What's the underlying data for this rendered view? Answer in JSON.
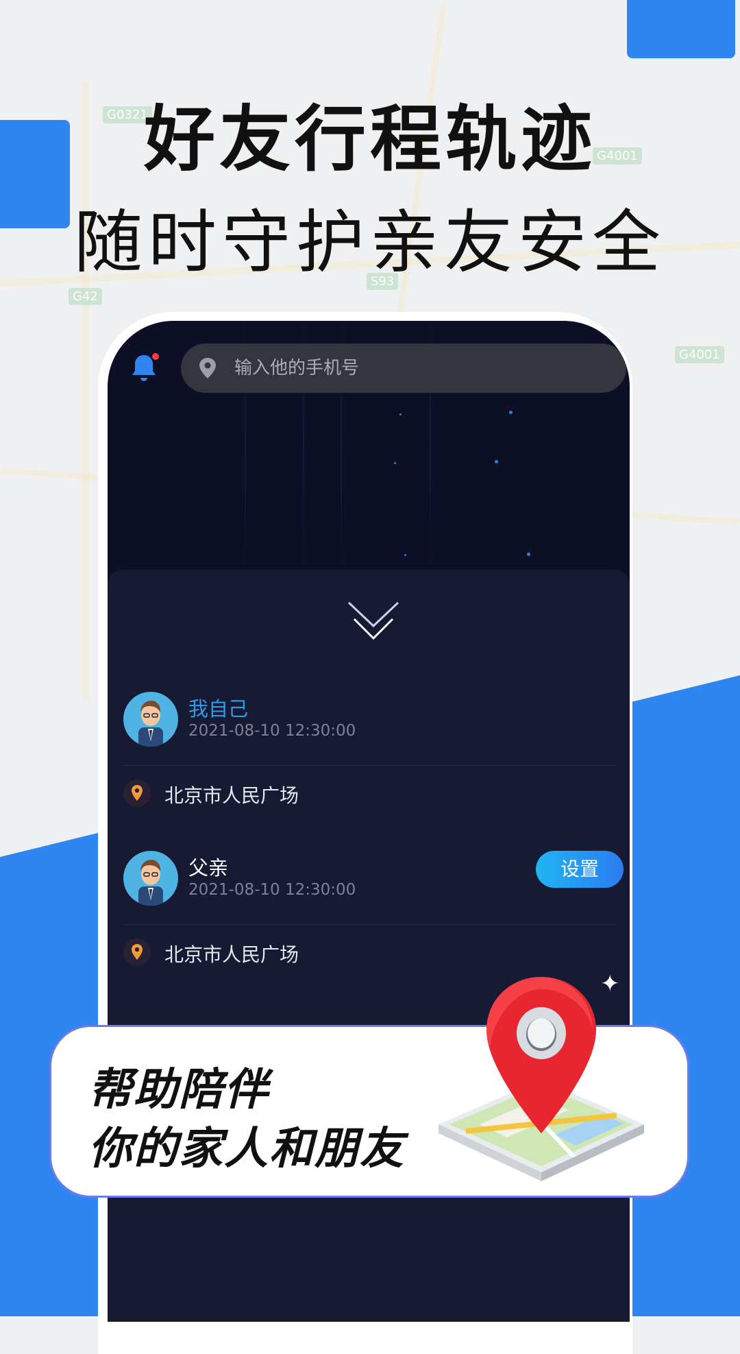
{
  "headline": {
    "line1": "好友行程轨迹",
    "line2": "随时守护亲友安全"
  },
  "map_labels": [
    "G0321",
    "G4001",
    "G42",
    "S93",
    "G4001"
  ],
  "search": {
    "placeholder": "输入他的手机号"
  },
  "contacts": [
    {
      "name": "我自己",
      "name_color": "#2f9be8",
      "time": "2021-08-10 12:30:00",
      "location": "北京市人民广场",
      "action_label": ""
    },
    {
      "name": "父亲",
      "name_color": "#ffffff",
      "time": "2021-08-10 12:30:00",
      "location": "北京市人民广场",
      "action_label": "设置"
    }
  ],
  "promo": {
    "line1": "帮助陪伴",
    "line2": "你的家人和朋友"
  },
  "colors": {
    "accent_blue": "#2f86f0",
    "screen_bg": "#0d0f27",
    "sheet_bg": "#161a32",
    "pin_red": "#e8262f"
  },
  "icons": [
    "bell-icon",
    "location-pin-icon",
    "chevron-down-icon",
    "map-pin-icon",
    "sparkle-icon"
  ]
}
